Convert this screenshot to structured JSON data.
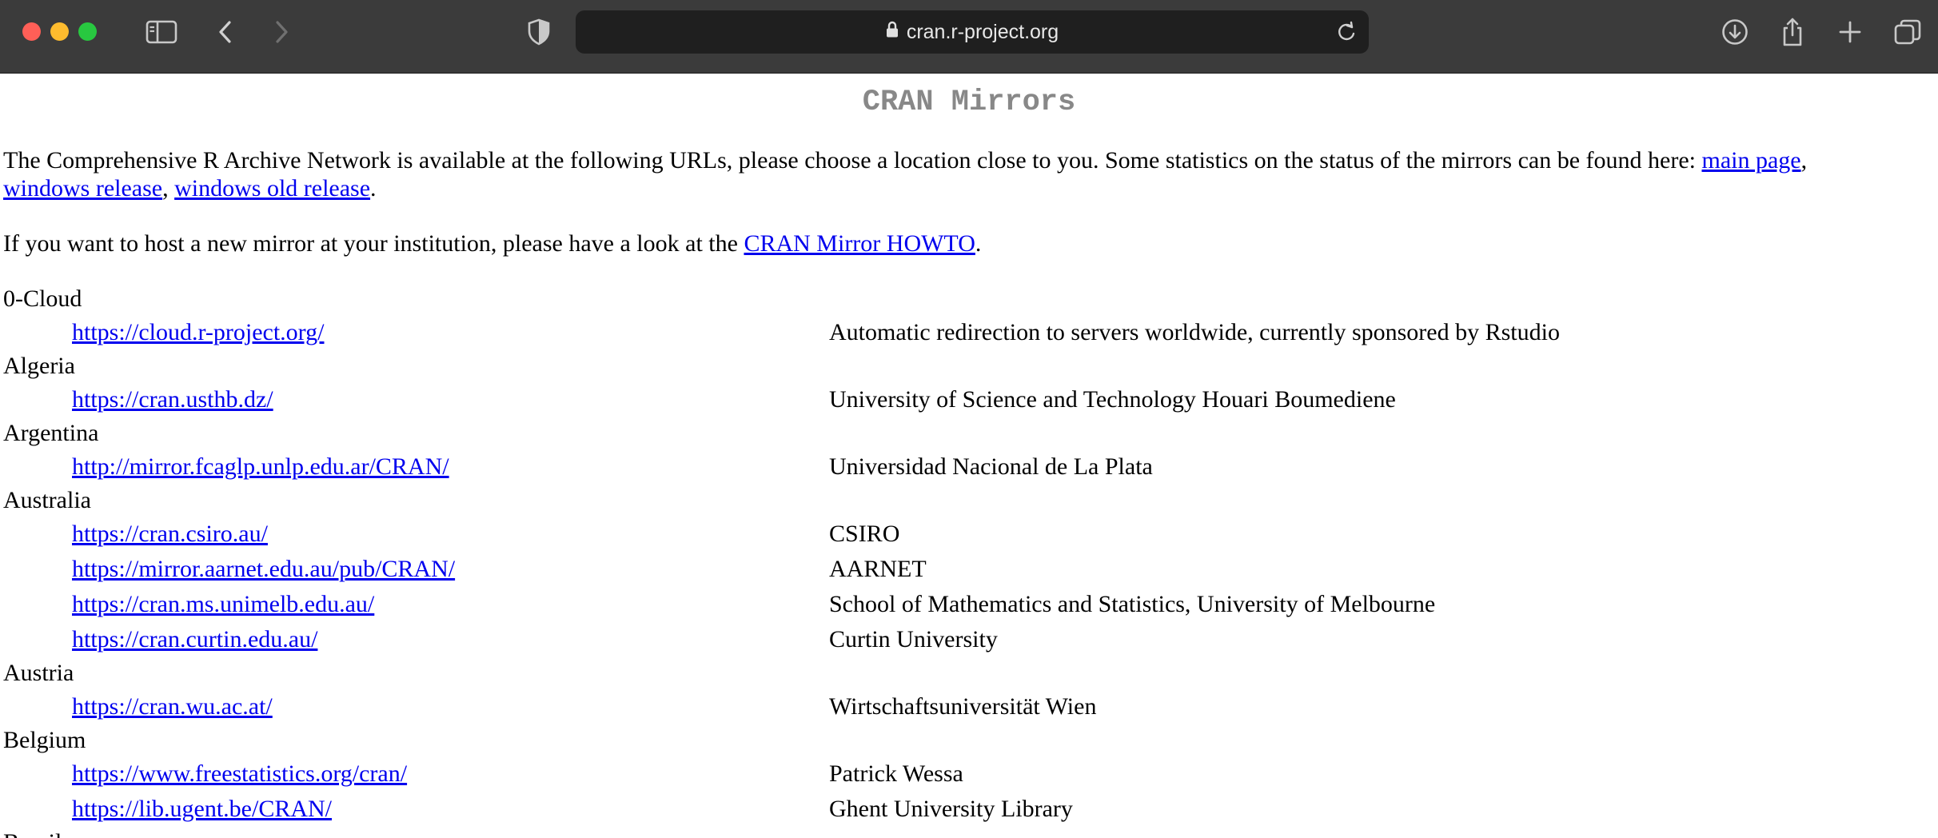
{
  "browser": {
    "url": "cran.r-project.org"
  },
  "page": {
    "title": "CRAN Mirrors",
    "intro": {
      "text": "The Comprehensive R Archive Network is available at the following URLs, please choose a location close to you. Some statistics on the status of the mirrors can be found here: ",
      "link1": "main page",
      "sep1": ",",
      "link2": "windows release",
      "sep2": ", ",
      "link3": "windows old release",
      "end": "."
    },
    "host": {
      "text": "If you want to host a new mirror at your institution, please have a look at the ",
      "link": "CRAN Mirror HOWTO",
      "end": "."
    },
    "countries": [
      {
        "name": "0-Cloud",
        "mirrors": [
          {
            "url": "https://cloud.r-project.org/",
            "desc": "Automatic redirection to servers worldwide, currently sponsored by Rstudio"
          }
        ]
      },
      {
        "name": "Algeria",
        "mirrors": [
          {
            "url": "https://cran.usthb.dz/",
            "desc": "University of Science and Technology Houari Boumediene"
          }
        ]
      },
      {
        "name": "Argentina",
        "mirrors": [
          {
            "url": "http://mirror.fcaglp.unlp.edu.ar/CRAN/",
            "desc": "Universidad Nacional de La Plata"
          }
        ]
      },
      {
        "name": "Australia",
        "mirrors": [
          {
            "url": "https://cran.csiro.au/",
            "desc": "CSIRO"
          },
          {
            "url": "https://mirror.aarnet.edu.au/pub/CRAN/",
            "desc": "AARNET"
          },
          {
            "url": "https://cran.ms.unimelb.edu.au/",
            "desc": "School of Mathematics and Statistics, University of Melbourne"
          },
          {
            "url": "https://cran.curtin.edu.au/",
            "desc": "Curtin University"
          }
        ]
      },
      {
        "name": "Austria",
        "mirrors": [
          {
            "url": "https://cran.wu.ac.at/",
            "desc": "Wirtschaftsuniversität Wien"
          }
        ]
      },
      {
        "name": "Belgium",
        "mirrors": [
          {
            "url": "https://www.freestatistics.org/cran/",
            "desc": "Patrick Wessa"
          },
          {
            "url": "https://lib.ugent.be/CRAN/",
            "desc": "Ghent University Library"
          }
        ]
      },
      {
        "name": "Brazil",
        "mirrors": []
      }
    ]
  }
}
